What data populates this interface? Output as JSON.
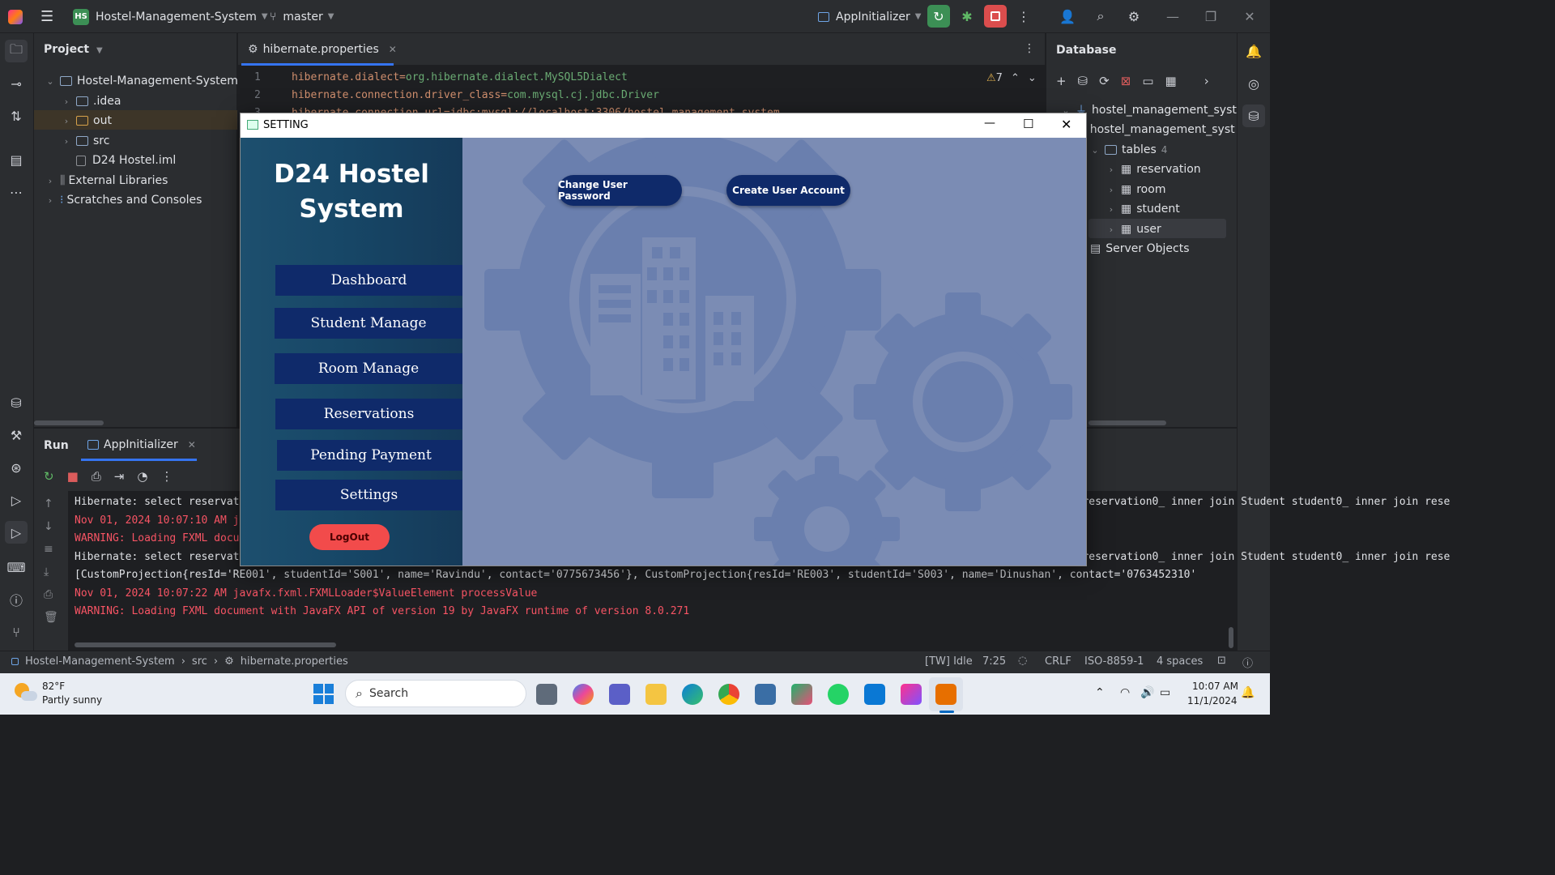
{
  "titlebar": {
    "project_badge": "HS",
    "project_name": "Hostel-Management-System",
    "branch": "master",
    "run_config": "AppInitializer"
  },
  "project_panel": {
    "title": "Project",
    "tree": [
      {
        "label": "Hostel-Management-System [D",
        "level": 0
      },
      {
        "label": ".idea",
        "level": 1
      },
      {
        "label": "out",
        "level": 1
      },
      {
        "label": "src",
        "level": 1
      },
      {
        "label": "D24 Hostel.iml",
        "level": 1
      },
      {
        "label": "External Libraries",
        "level": 0
      },
      {
        "label": "Scratches and Consoles",
        "level": 0
      }
    ]
  },
  "editor": {
    "tab_label": "hibernate.properties",
    "warning_count": "7",
    "lines": [
      {
        "num": "1",
        "key": "hibernate.dialect=",
        "value": "org.hibernate.dialect.MySQL5Dialect"
      },
      {
        "num": "2",
        "key": "hibernate.connection.driver_class=",
        "value": "com.mysql.cj.jdbc.Driver"
      },
      {
        "num": "3",
        "key": "hibernate.connection.url=jdbc:mysql://localhost:3306/hostel_management_system",
        "value": ""
      }
    ]
  },
  "database_panel": {
    "title": "Database",
    "tree": [
      {
        "label": "hostel_management_system"
      },
      {
        "label": "hostel_management_syst"
      },
      {
        "label": "tables",
        "count": "4"
      },
      {
        "label": "reservation"
      },
      {
        "label": "room"
      },
      {
        "label": "student"
      },
      {
        "label": "user"
      },
      {
        "label": "Server Objects"
      }
    ]
  },
  "run_panel": {
    "title": "Run",
    "tab": "AppInitializer",
    "console": [
      {
        "text": "Hibernate: select reservation0_.resId as col_0_0_, student1_.studentId as col_1_0_, student1_.name as col_2_0_, student1_.contact as col_3_0_ from Reservation reservation0_ inner join Student student0_ inner join rese",
        "type": "white"
      },
      {
        "text": "Nov 01, 2024 10:07:10 AM javafx.fxml.FXMLLoader$ValueElement processValue",
        "type": "red"
      },
      {
        "text": "WARNING: Loading FXML document with JavaFX API of version 19 by JavaFX runtime of version 8.0.271",
        "type": "red"
      },
      {
        "text": "Hibernate: select reservation0_.resId as col_0_0_, student1_.studentId as col_1_0_, student1_.name as col_2_0_, student1_.contact as col_3_0_ from Reservation reservation0_ inner join Student student0_ inner join rese",
        "type": "white"
      },
      {
        "text": "[CustomProjection{resId='RE001', studentId='S001', name='Ravindu', contact='0775673456'}, CustomProjection{resId='RE003', studentId='S003', name='Dinushan', contact='0763452310'",
        "type": "white"
      },
      {
        "text": "Nov 01, 2024 10:07:22 AM javafx.fxml.FXMLLoader$ValueElement processValue",
        "type": "red"
      },
      {
        "text": "WARNING: Loading FXML document with JavaFX API of version 19 by JavaFX runtime of version 8.0.271",
        "type": "red"
      }
    ]
  },
  "statusbar": {
    "crumbs": [
      "Hostel-Management-System",
      "src",
      "hibernate.properties"
    ],
    "idle": "[TW] Idle",
    "position": "7:25",
    "line_sep": "CRLF",
    "encoding": "ISO-8859-1",
    "indent": "4 spaces"
  },
  "fx_window": {
    "title": "SETTING",
    "app_title": "D24 Hostel System",
    "nav": [
      "Dashboard",
      "Student Manage",
      "Room Manage",
      "Reservations",
      "Pending Payment",
      "Settings"
    ],
    "logout": "LogOut",
    "change_password": "Change User Password",
    "create_account": "Create User Account"
  },
  "taskbar": {
    "weather_temp": "82°F",
    "weather_desc": "Partly sunny",
    "search": "Search",
    "time": "10:07 AM",
    "date": "11/1/2024"
  },
  "colors": {
    "nav_button": "#0f2a6a",
    "logout": "#f24b4b",
    "main_bg": "#7b8cb4",
    "console_error": "#f75464"
  }
}
